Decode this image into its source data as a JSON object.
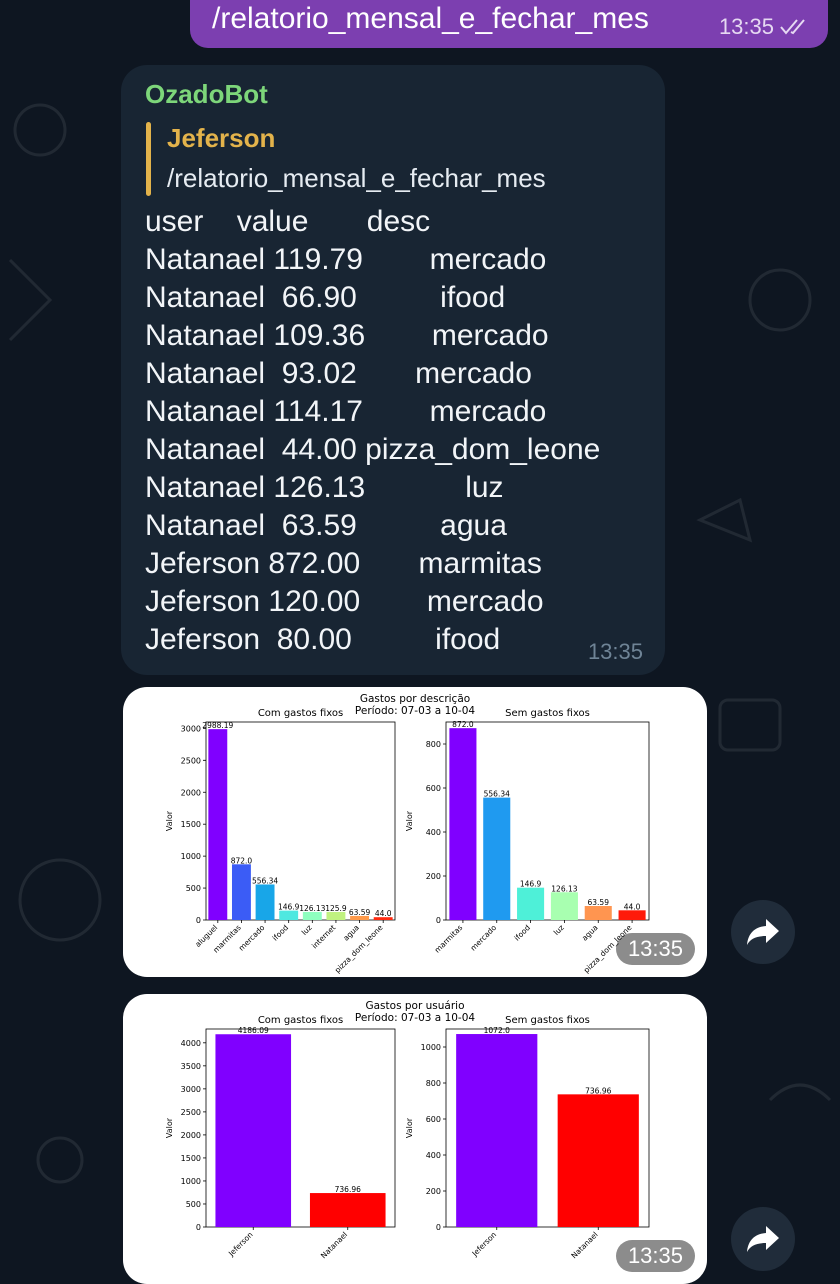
{
  "outgoing": {
    "text": "/relatorio_mensal_e_fechar_mes",
    "time": "13:35",
    "status_icon": "double-check-icon"
  },
  "incoming": {
    "sender": "OzadoBot",
    "reply_to": {
      "name": "Jeferson",
      "text": "/relatorio_mensal_e_fechar_mes"
    },
    "lines": [
      "user    value       desc",
      "Natanael 119.79        mercado",
      "Natanael  66.90          ifood",
      "Natanael 109.36        mercado",
      "Natanael  93.02       mercado",
      "Natanael 114.17        mercado",
      "Natanael  44.00 pizza_dom_leone",
      "Natanael 126.13            luz",
      "Natanael  63.59          agua",
      "Jeferson 872.00       marmitas",
      "Jeferson 120.00        mercado",
      "Jeferson  80.00          ifood"
    ],
    "time": "13:35"
  },
  "images": [
    {
      "time": "13:35",
      "suptitle": "Gastos por descrição",
      "period": "Período: 07-03 a 10-04",
      "share_icon": "forward-arrow-icon"
    },
    {
      "time": "13:35",
      "suptitle": "Gastos por usuário",
      "period": "Período: 07-03 a 10-04",
      "share_icon": "forward-arrow-icon"
    }
  ],
  "chart_data": [
    {
      "type": "bar",
      "title": "Com gastos fixos",
      "ylabel": "Valor",
      "categories": [
        "aluguel",
        "marmitas",
        "mercado",
        "ifood",
        "luz",
        "internet",
        "agua",
        "pizza_dom_leone"
      ],
      "values": [
        2988.19,
        872.0,
        556.34,
        146.9,
        126.13,
        125.9,
        63.59,
        44.0
      ],
      "labels": [
        "2988.19",
        "872.0",
        "556.34",
        "146.9",
        "126.13",
        "125.9",
        "63.59",
        "44.0"
      ],
      "colors": [
        "#8000ff",
        "#3b5cf6",
        "#18a6e8",
        "#4fe8e0",
        "#8effbf",
        "#c0f280",
        "#ff9a4a",
        "#ff2a10"
      ],
      "ylim": [
        0,
        3100
      ],
      "yticks": [
        0,
        500,
        1000,
        1500,
        2000,
        2500,
        3000
      ]
    },
    {
      "type": "bar",
      "title": "Sem gastos fixos",
      "ylabel": "Valor",
      "categories": [
        "marmitas",
        "mercado",
        "ifood",
        "luz",
        "agua",
        "pizza_dom_leone"
      ],
      "values": [
        872.0,
        556.34,
        146.9,
        126.13,
        63.59,
        44.0
      ],
      "labels": [
        "872.0",
        "556.34",
        "146.9",
        "126.13",
        "63.59",
        "44.0"
      ],
      "colors": [
        "#8000ff",
        "#1f9af0",
        "#4ef0d8",
        "#a8ffb0",
        "#ff9550",
        "#ff1a0a"
      ],
      "ylim": [
        0,
        900
      ],
      "yticks": [
        0,
        200,
        400,
        600,
        800
      ]
    },
    {
      "type": "bar",
      "title": "Com gastos fixos",
      "ylabel": "Valor",
      "categories": [
        "Jeferson",
        "Natanael"
      ],
      "values": [
        4186.09,
        736.96
      ],
      "labels": [
        "4186.09",
        "736.96"
      ],
      "colors": [
        "#8000ff",
        "#ff0000"
      ],
      "ylim": [
        0,
        4300
      ],
      "yticks": [
        0,
        500,
        1000,
        1500,
        2000,
        2500,
        3000,
        3500,
        4000
      ]
    },
    {
      "type": "bar",
      "title": "Sem gastos fixos",
      "ylabel": "Valor",
      "categories": [
        "Jeferson",
        "Natanael"
      ],
      "values": [
        1072.0,
        736.96
      ],
      "labels": [
        "1072.0",
        "736.96"
      ],
      "colors": [
        "#8000ff",
        "#ff0000"
      ],
      "ylim": [
        0,
        1100
      ],
      "yticks": [
        0,
        200,
        400,
        600,
        800,
        1000
      ]
    }
  ]
}
